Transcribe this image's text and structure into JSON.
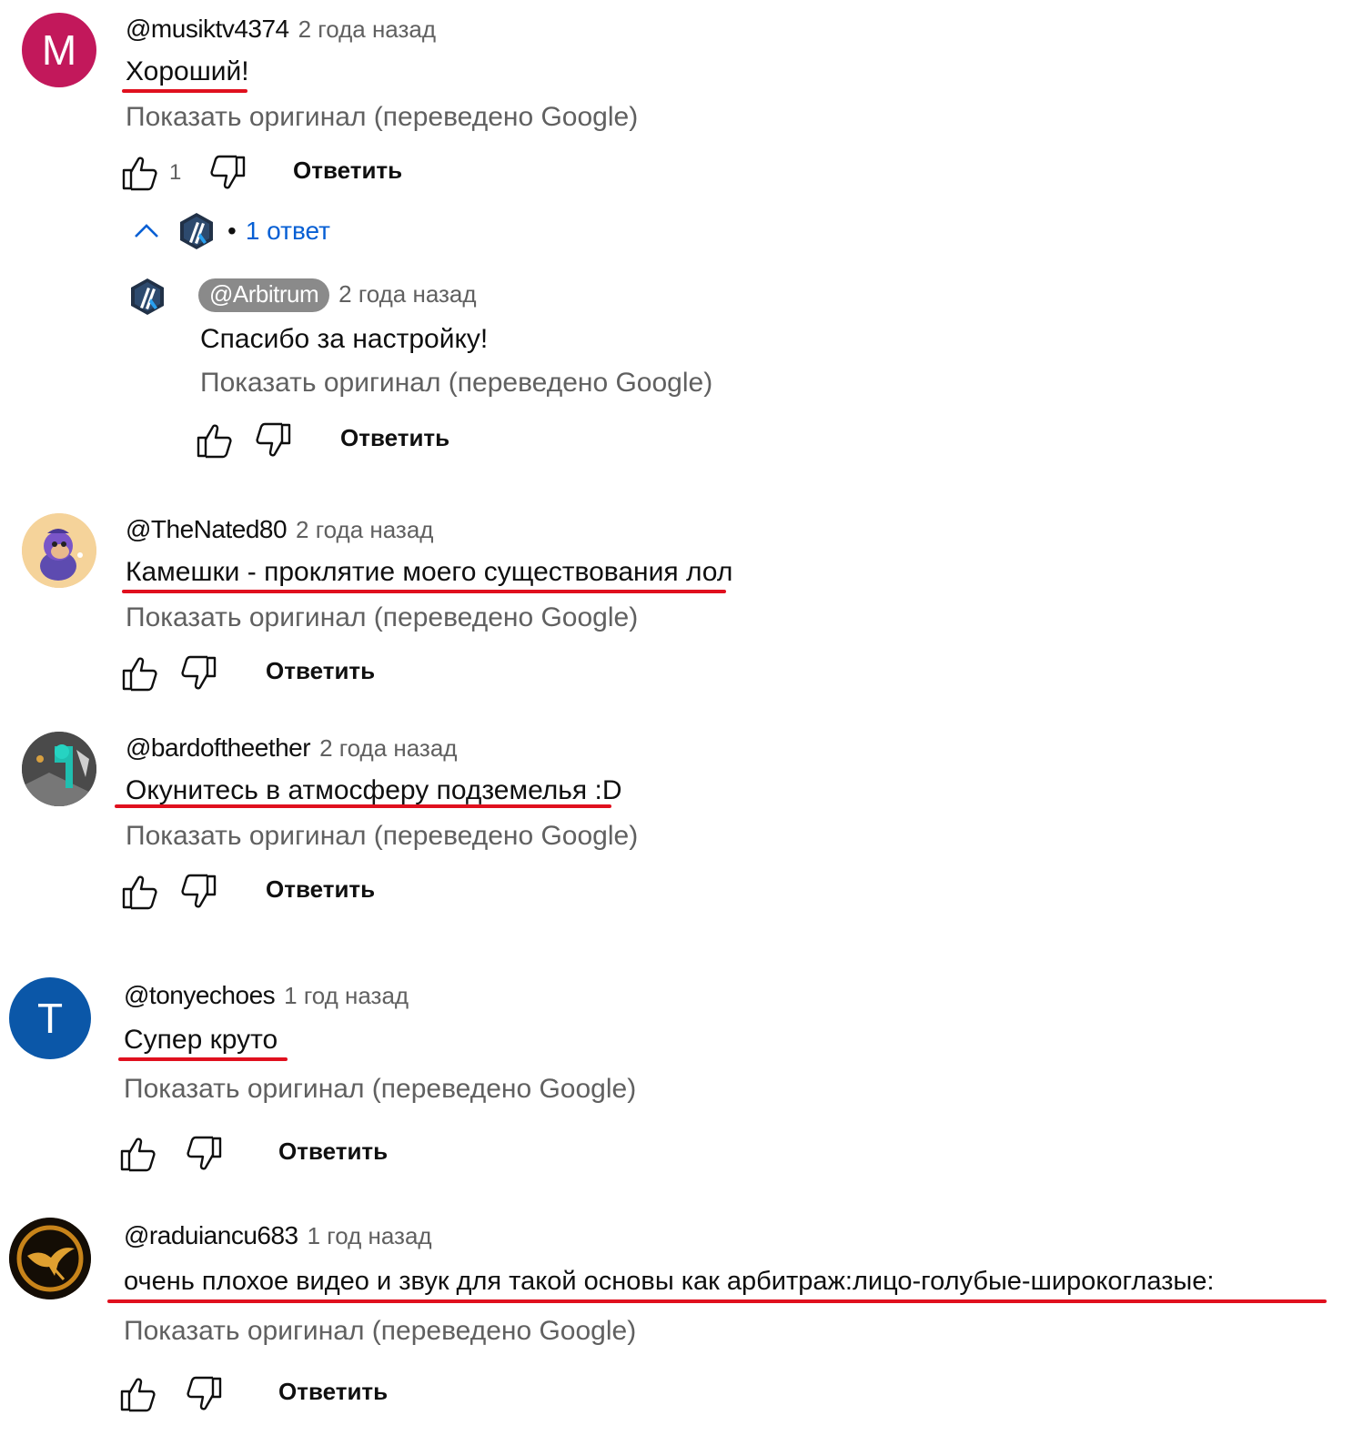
{
  "ui": {
    "translate_label": "Показать оригинал (переведено Google)",
    "reply_label": "Ответить",
    "colors": {
      "underline": "#e0101e",
      "link": "#065fd4",
      "muted": "#606060"
    }
  },
  "comments": [
    {
      "author": "@musiktv4374",
      "time": "2 года назад",
      "avatar_letter": "M",
      "avatar_color": "#c2185b",
      "text": "Хороший!",
      "likes": "1",
      "replies_toggle": "1 ответ"
    },
    {
      "author": "@TheNated80",
      "time": "2 года назад",
      "avatar_icon": "cartoon-monkey-avatar",
      "text": "Камешки - проклятие моего существования лол"
    },
    {
      "author": "@bardoftheether",
      "time": "2 года назад",
      "avatar_icon": "teal-figure-avatar",
      "text": "Окунитесь в атмосферу подземелья :D"
    },
    {
      "author": "@tonyechoes",
      "time": "1 год назад",
      "avatar_letter": "T",
      "avatar_color": "#0b57a8",
      "text": "Супер круто"
    },
    {
      "author": "@raduiancu683",
      "time": "1 год назад",
      "avatar_icon": "mockingjay-avatar",
      "text": "очень плохое видео и звук для такой основы как арбитраж:лицо-голубые-широкоглазые:"
    }
  ],
  "reply": {
    "author": "@Arbitrum",
    "time": "2 года назад",
    "avatar_icon": "arbitrum-logo",
    "text": "Спасибо за настройку!"
  }
}
